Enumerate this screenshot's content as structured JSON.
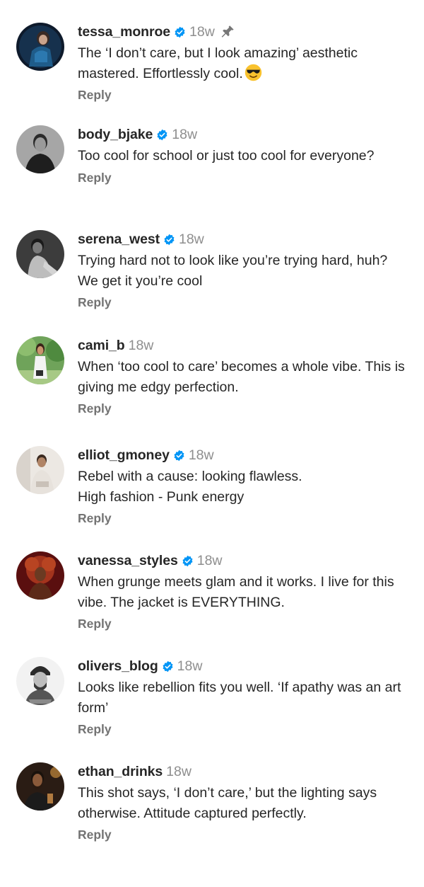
{
  "comments": [
    {
      "username": "tessa_monroe",
      "verified": true,
      "time": "18w",
      "pinned": true,
      "text": "The ‘I don’t care, but I look amazing’ aesthetic mastered. Effortlessly cool.",
      "emoji": "smiling-face-with-sunglasses",
      "reply_label": "Reply"
    },
    {
      "username": "body_bjake",
      "verified": true,
      "time": "18w",
      "pinned": false,
      "text": "Too cool for school or just too cool for everyone?",
      "reply_label": "Reply"
    },
    {
      "username": "serena_west",
      "verified": true,
      "time": "18w",
      "pinned": false,
      "text": "Trying hard not to look like you’re trying hard, huh? We get it you’re cool",
      "reply_label": "Reply"
    },
    {
      "username": "cami_b",
      "verified": false,
      "time": "18w",
      "pinned": false,
      "text": "When ‘too cool to care’ becomes a whole vibe. This is giving me edgy perfection.",
      "reply_label": "Reply"
    },
    {
      "username": "elliot_gmoney",
      "verified": true,
      "time": "18w",
      "pinned": false,
      "text_lines": [
        "Rebel with a cause: looking flawless.",
        "High fashion - Punk energy"
      ],
      "reply_label": "Reply"
    },
    {
      "username": "vanessa_styles",
      "verified": true,
      "time": "18w",
      "pinned": false,
      "text": "When grunge meets glam and it works. I live for this vibe. The jacket is EVERYTHING.",
      "reply_label": "Reply"
    },
    {
      "username": "olivers_blog",
      "verified": true,
      "time": "18w",
      "pinned": false,
      "text": "Looks like rebellion fits you well. ‘If apathy was an art form’",
      "reply_label": "Reply"
    },
    {
      "username": "ethan_drinks",
      "verified": false,
      "time": "18w",
      "pinned": false,
      "text": "This shot says, ‘I don’t care,’ but the lighting says otherwise. Attitude captured perfectly.",
      "reply_label": "Reply"
    }
  ],
  "colors": {
    "verified_badge": "#0095f6",
    "username": "#262626",
    "timestamp": "#8e8e8e",
    "reply": "#737373"
  },
  "icons": {
    "verified": "verified-badge-icon",
    "pin": "pin-icon"
  }
}
